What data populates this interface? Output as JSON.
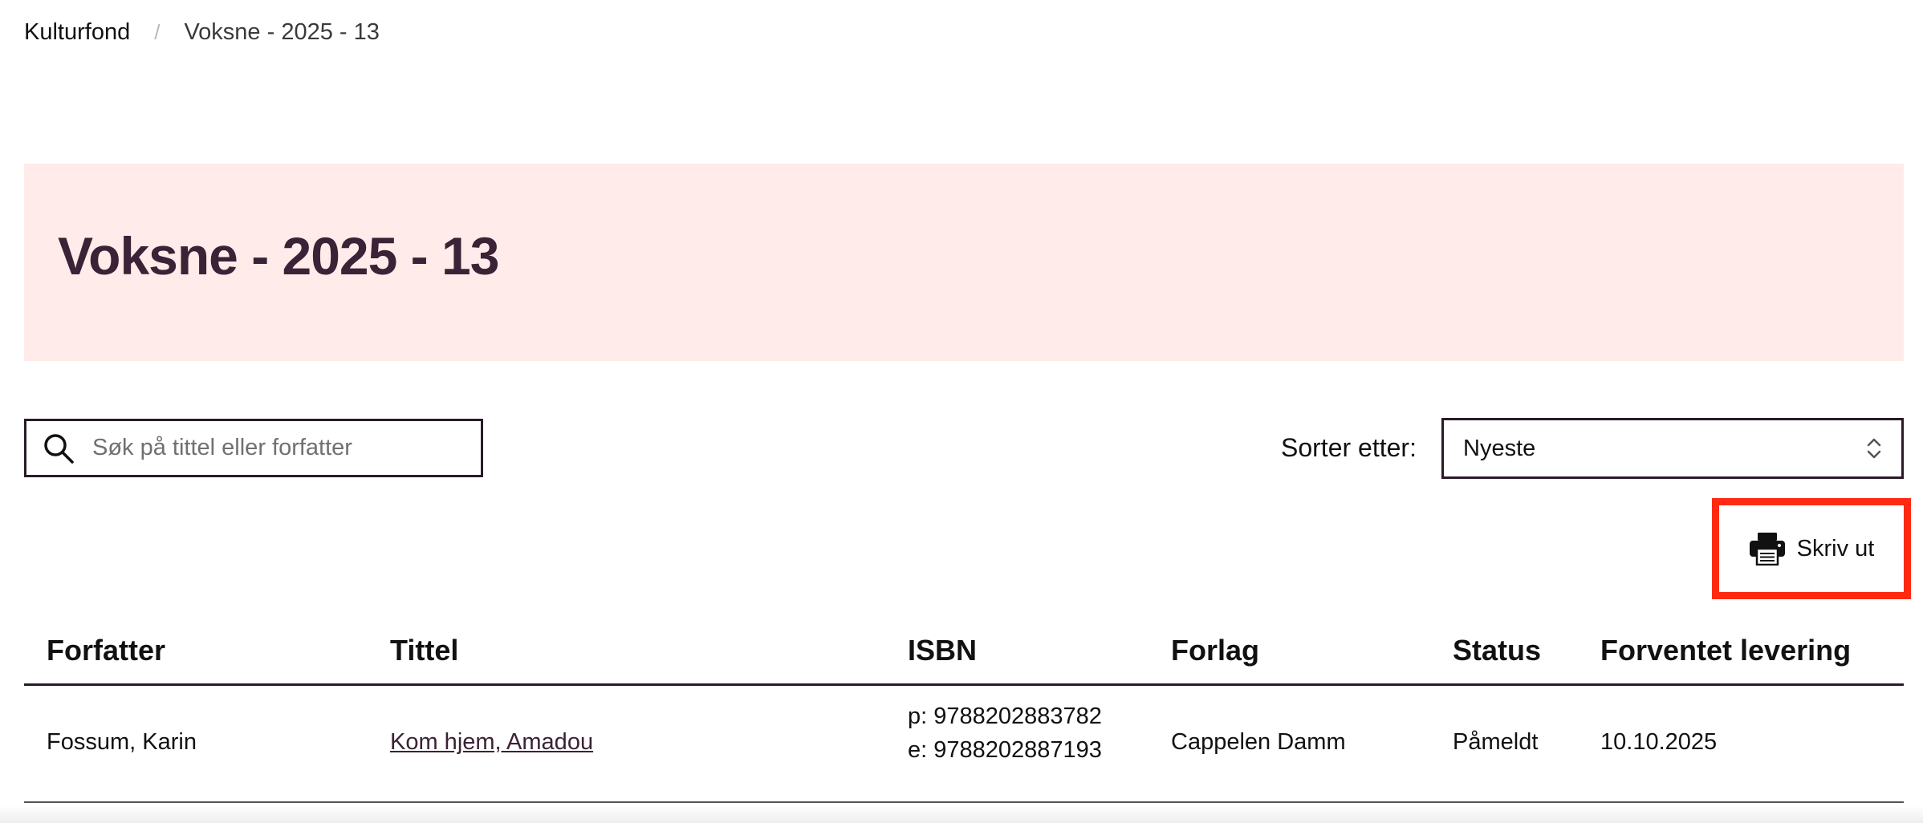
{
  "breadcrumb": {
    "home": "Kulturfond",
    "separator": "/",
    "current": "Voksne - 2025 - 13"
  },
  "hero": {
    "title": "Voksne - 2025 - 13",
    "background": "#ffebe9",
    "title_color": "#3b2236"
  },
  "search": {
    "placeholder": "Søk på tittel eller forfatter",
    "value": "",
    "icon": "search-icon"
  },
  "sort": {
    "label": "Sorter etter:",
    "selected": "Nyeste",
    "icon": "chevron-up-down-icon"
  },
  "print": {
    "label": "Skriv ut",
    "icon": "printer-icon",
    "highlight_color": "#ff2a12"
  },
  "table": {
    "headers": [
      "Forfatter",
      "Tittel",
      "ISBN",
      "Forlag",
      "Status",
      "Forventet levering"
    ],
    "rows": [
      {
        "author": "Fossum, Karin",
        "title": "Kom hjem, Amadou",
        "isbn_print": "p: 9788202883782",
        "isbn_ebook": "e: 9788202887193",
        "publisher": "Cappelen Damm",
        "status": "Påmeldt",
        "delivery": "10.10.2025"
      }
    ]
  }
}
